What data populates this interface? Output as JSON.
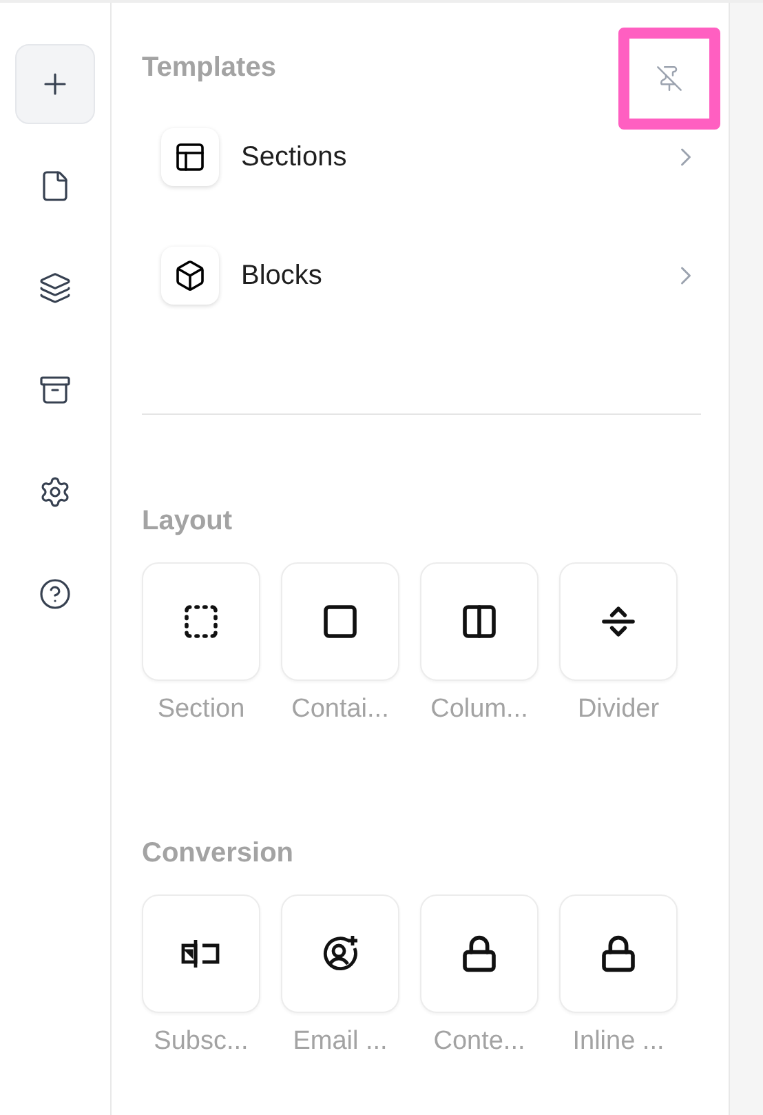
{
  "rail": {
    "items": [
      {
        "kind": "add",
        "selected": true
      },
      {
        "kind": "page",
        "selected": false
      },
      {
        "kind": "layers",
        "selected": false
      },
      {
        "kind": "storage",
        "selected": false
      },
      {
        "kind": "settings",
        "selected": false
      },
      {
        "kind": "help",
        "selected": false
      }
    ]
  },
  "panel": {
    "title": "Templates",
    "pin": {
      "highlighted": true
    },
    "templates": [
      {
        "kind": "sections",
        "label": "Sections"
      },
      {
        "kind": "blocks",
        "label": "Blocks"
      }
    ],
    "groups": [
      {
        "title": "Layout",
        "items": [
          {
            "kind": "section",
            "label": "Section"
          },
          {
            "kind": "container",
            "label": "Contai..."
          },
          {
            "kind": "columns",
            "label": "Colum..."
          },
          {
            "kind": "divider",
            "label": "Divider"
          }
        ]
      },
      {
        "title": "Conversion",
        "items": [
          {
            "kind": "subscribe",
            "label": "Subsc..."
          },
          {
            "kind": "email",
            "label": "Email ..."
          },
          {
            "kind": "lock",
            "label": "Conte..."
          },
          {
            "kind": "lock",
            "label": "Inline ..."
          }
        ]
      }
    ]
  }
}
